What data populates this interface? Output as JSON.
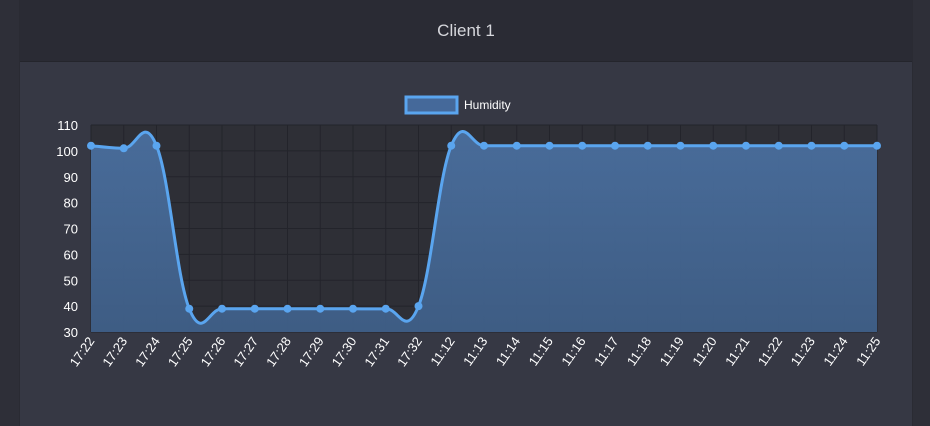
{
  "panel": {
    "title": "Client 1"
  },
  "colors": {
    "line": "#5aa5ef",
    "fill": "#45699a",
    "plot_bg": "#2e2f36",
    "grid": "#23242b",
    "text": "#ffffff"
  },
  "chart_data": {
    "type": "area",
    "categories": [
      "17:22",
      "17:23",
      "17:24",
      "17:25",
      "17:26",
      "17:27",
      "17:28",
      "17:29",
      "17:30",
      "17:31",
      "17:32",
      "11:12",
      "11:13",
      "11:14",
      "11:15",
      "11:16",
      "11:17",
      "11:18",
      "11:19",
      "11:20",
      "11:21",
      "11:22",
      "11:23",
      "11:24",
      "11:25"
    ],
    "series": [
      {
        "name": "Humidity",
        "values": [
          102,
          101,
          102,
          39,
          39,
          39,
          39,
          39,
          39,
          39,
          40,
          102,
          102,
          102,
          102,
          102,
          102,
          102,
          102,
          102,
          102,
          102,
          102,
          102,
          102
        ]
      }
    ],
    "ylim": [
      30,
      110
    ],
    "yticks": [
      110,
      100,
      90,
      80,
      70,
      60,
      50,
      40,
      30
    ],
    "grid": true,
    "legend_position": "top-center",
    "title": "",
    "xlabel": "",
    "ylabel": ""
  }
}
